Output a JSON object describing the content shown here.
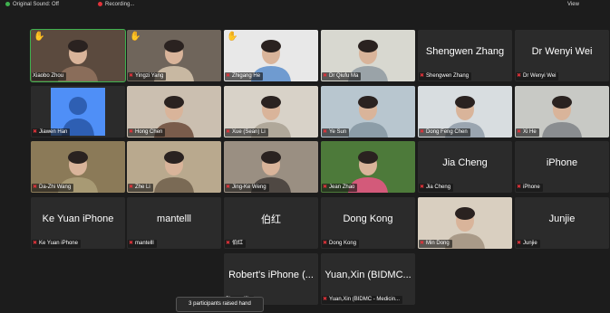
{
  "topbar": {
    "audio_status": "Original Sound: Off",
    "recording_status": "Recording...",
    "view_label": "View"
  },
  "participants": [
    {
      "name": "Xiaobo Zhou",
      "hand_raised": true,
      "muted": false,
      "video": true,
      "active": true
    },
    {
      "name": "Yingzi Yang",
      "hand_raised": true,
      "muted": true,
      "video": true
    },
    {
      "name": "Zhigang He",
      "hand_raised": true,
      "muted": true,
      "video": true
    },
    {
      "name": "Dr Qiufu Ma",
      "hand_raised": false,
      "muted": true,
      "video": true
    },
    {
      "name": "Shengwen Zhang",
      "display": "Shengwen Zhang",
      "muted": true,
      "video": false
    },
    {
      "name": "Dr Wenyi Wei",
      "display": "Dr Wenyi Wei",
      "muted": true,
      "video": false
    },
    {
      "name": "Jiawen Han",
      "muted": true,
      "video": false,
      "avatar": true
    },
    {
      "name": "Hong Chen",
      "muted": true,
      "video": true
    },
    {
      "name": "Xue (Sean) Li",
      "muted": true,
      "video": true
    },
    {
      "name": "Ye Sun",
      "muted": true,
      "video": true
    },
    {
      "name": "Dong Feng Chen",
      "muted": true,
      "video": true
    },
    {
      "name": "Xi He",
      "muted": true,
      "video": true
    },
    {
      "name": "Da-Zhi Wang",
      "muted": true,
      "video": true
    },
    {
      "name": "Zhe Li",
      "muted": true,
      "video": true
    },
    {
      "name": "Jing-Ke Weng",
      "muted": true,
      "video": true
    },
    {
      "name": "Jean Zhao",
      "muted": true,
      "video": true
    },
    {
      "name": "Jia Cheng",
      "display": "Jia Cheng",
      "muted": true,
      "video": false
    },
    {
      "name": "iPhone",
      "display": "iPhone",
      "muted": true,
      "video": false
    },
    {
      "name": "Ke Yuan iPhone",
      "display": "Ke Yuan iPhone",
      "muted": true,
      "video": false
    },
    {
      "name": "mantelll",
      "display": "mantelll",
      "muted": true,
      "video": false
    },
    {
      "name": "伯红",
      "display": "伯红",
      "muted": true,
      "video": false
    },
    {
      "name": "Dong Kong",
      "display": "Dong Kong",
      "muted": true,
      "video": false
    },
    {
      "name": "Min Dong",
      "muted": true,
      "video": true
    },
    {
      "name": "Junjie",
      "display": "Junjie",
      "muted": true,
      "video": false
    },
    {
      "name": "Phone (2),",
      "display": "Robert's iPhone (...",
      "muted": false,
      "video": false
    },
    {
      "name": "Yuan,Xin (BIDMC - Medicin...",
      "display": "Yuan,Xin (BIDMC...",
      "muted": true,
      "video": false
    }
  ],
  "toast": "3 participants raised hand",
  "colors": {
    "background": "#1c1c1c",
    "tile": "#2b2b2b",
    "active_border": "#3fb24f",
    "muted_icon": "#e0333a",
    "hand_icon": "#f2c035"
  }
}
